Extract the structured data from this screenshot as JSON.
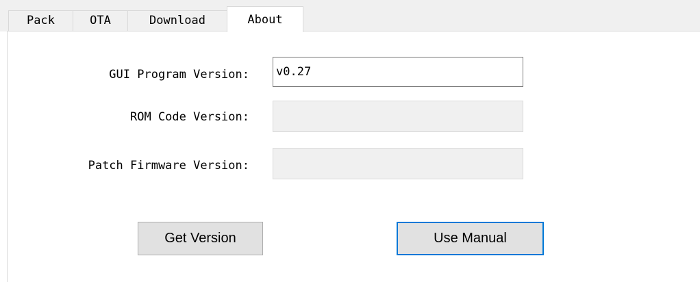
{
  "tabs": [
    {
      "label": "Pack"
    },
    {
      "label": "OTA"
    },
    {
      "label": "Download"
    },
    {
      "label": "About"
    }
  ],
  "active_tab": "About",
  "about": {
    "gui_version_label": "GUI Program Version:",
    "gui_version_value": "v0.27",
    "rom_version_label": "ROM Code Version:",
    "rom_version_value": "",
    "patch_version_label": "Patch Firmware Version:",
    "patch_version_value": "",
    "get_version_button": "Get Version",
    "use_manual_button": "Use Manual"
  },
  "colors": {
    "focus_border": "#0078d7",
    "button_face": "#e1e1e1",
    "readonly_field": "#f0f0f0"
  }
}
